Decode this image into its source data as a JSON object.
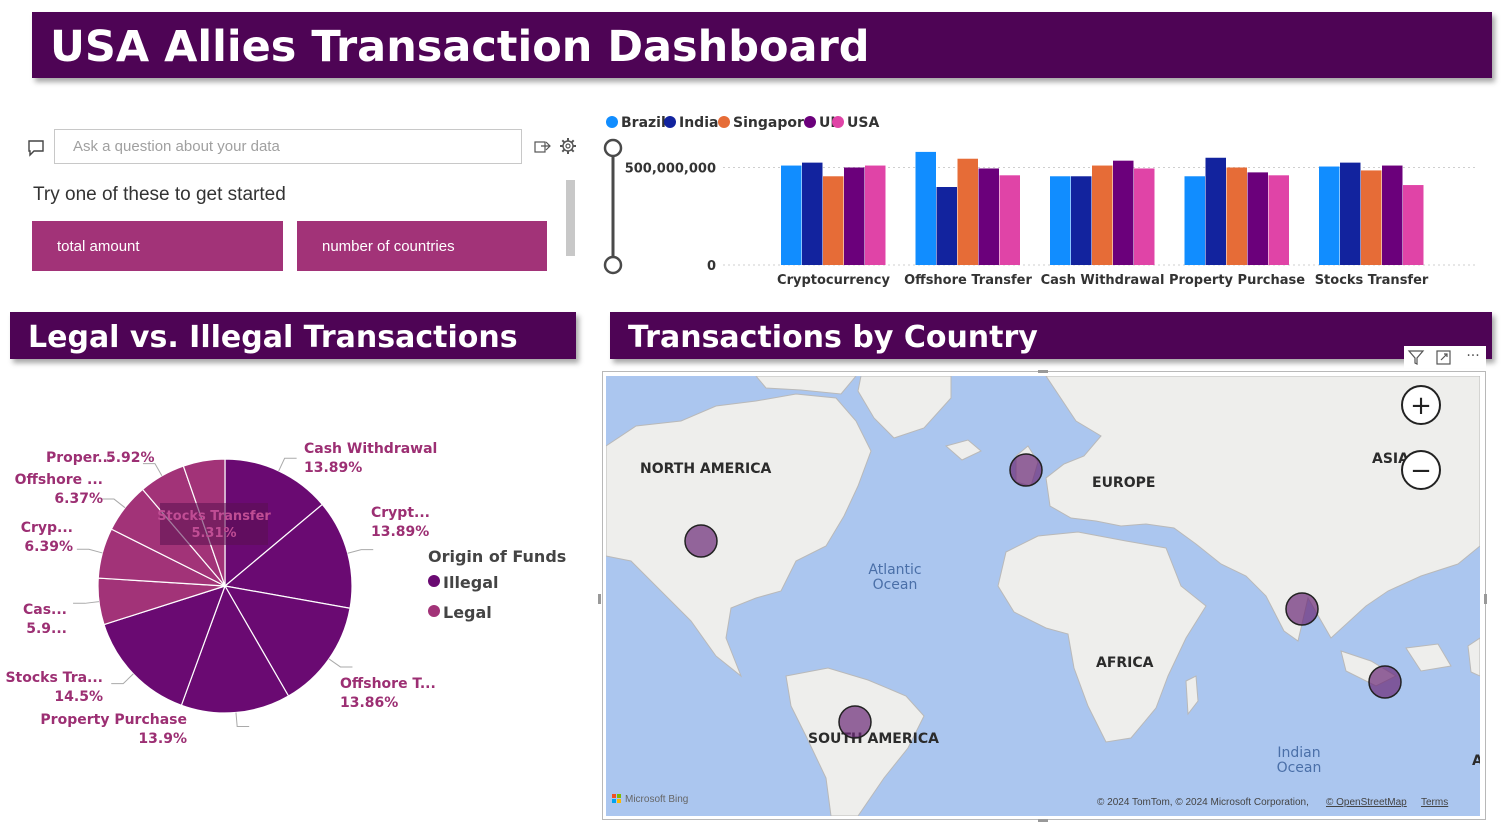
{
  "header": {
    "title": "USA Allies Transaction Dashboard"
  },
  "qa": {
    "placeholder": "Ask a question about your data",
    "hint": "Try one of these to get started",
    "suggestions": [
      "total amount",
      "number of countries"
    ]
  },
  "sections": {
    "legal": "Legal vs. Illegal Transactions",
    "country": "Transactions by Country"
  },
  "colors": {
    "banner": "#4e0455",
    "illegal": "#6a0a72",
    "legal": "#a23378",
    "brazil": "#118dff",
    "india": "#12239e",
    "singapore": "#e66c37",
    "uk": "#6b007b",
    "usa": "#e044a7"
  },
  "chart_data": [
    {
      "type": "bar",
      "categories": [
        "Cryptocurrency",
        "Offshore Transfer",
        "Cash Withdrawal",
        "Property Purchase",
        "Stocks Transfer"
      ],
      "series": [
        {
          "name": "Brazil",
          "color": "#118dff",
          "values": [
            510000000,
            580000000,
            455000000,
            455000000,
            505000000
          ]
        },
        {
          "name": "India",
          "color": "#12239e",
          "values": [
            525000000,
            400000000,
            455000000,
            550000000,
            525000000
          ]
        },
        {
          "name": "Singapore",
          "color": "#e66c37",
          "values": [
            455000000,
            545000000,
            510000000,
            500000000,
            485000000
          ]
        },
        {
          "name": "UK",
          "color": "#6b007b",
          "values": [
            500000000,
            495000000,
            535000000,
            475000000,
            510000000
          ]
        },
        {
          "name": "USA",
          "color": "#e044a7",
          "values": [
            510000000,
            460000000,
            495000000,
            460000000,
            410000000
          ]
        }
      ],
      "yticks": [
        "500,000,000",
        "0"
      ],
      "ytick_values": [
        500000000,
        0
      ],
      "ylim": [
        0,
        600000000
      ],
      "grid": true,
      "legend": "top-left"
    },
    {
      "type": "pie",
      "legend_title": "Origin of Funds",
      "legend": [
        {
          "name": "Illegal",
          "color": "#6a0a72"
        },
        {
          "name": "Legal",
          "color": "#a23378"
        }
      ],
      "slices": [
        {
          "label": "Cash Withdrawal",
          "value": 13.89,
          "text": "13.89%",
          "origin": "Illegal"
        },
        {
          "label": "Crypt...",
          "value": 13.89,
          "text": "13.89%",
          "origin": "Illegal"
        },
        {
          "label": "Offshore T...",
          "value": 13.86,
          "text": "13.86%",
          "origin": "Illegal"
        },
        {
          "label": "Property Purchase",
          "value": 13.9,
          "text": "13.9%",
          "origin": "Illegal"
        },
        {
          "label": "Stocks Tra...",
          "value": 14.5,
          "text": "14.5%",
          "origin": "Illegal"
        },
        {
          "label": "Cas...",
          "value": 5.9,
          "text": "5.9...",
          "origin": "Legal"
        },
        {
          "label": "Cryp...",
          "value": 6.39,
          "text": "6.39%",
          "origin": "Legal"
        },
        {
          "label": "Offshore ...",
          "value": 6.37,
          "text": "6.37%",
          "origin": "Legal"
        },
        {
          "label": "Proper...",
          "value": 5.92,
          "text": "5.92%",
          "origin": "Legal"
        },
        {
          "label": "Stocks Transfer",
          "value": 5.31,
          "text": "5.31%",
          "origin": "Legal"
        }
      ]
    }
  ],
  "map": {
    "continents": [
      "NORTH AMERICA",
      "EUROPE",
      "ASIA",
      "AFRICA",
      "SOUTH AMERICA"
    ],
    "oceans": [
      "Atlantic",
      "Ocean",
      "Indian",
      "Ocean"
    ],
    "edge_letter": "A",
    "bing": "Microsoft Bing",
    "attribution": "© 2024 TomTom, © 2024 Microsoft Corporation,",
    "osm": "© OpenStreetMap",
    "terms": "Terms",
    "zoom_in": "+",
    "zoom_out": "−",
    "more": "···"
  }
}
